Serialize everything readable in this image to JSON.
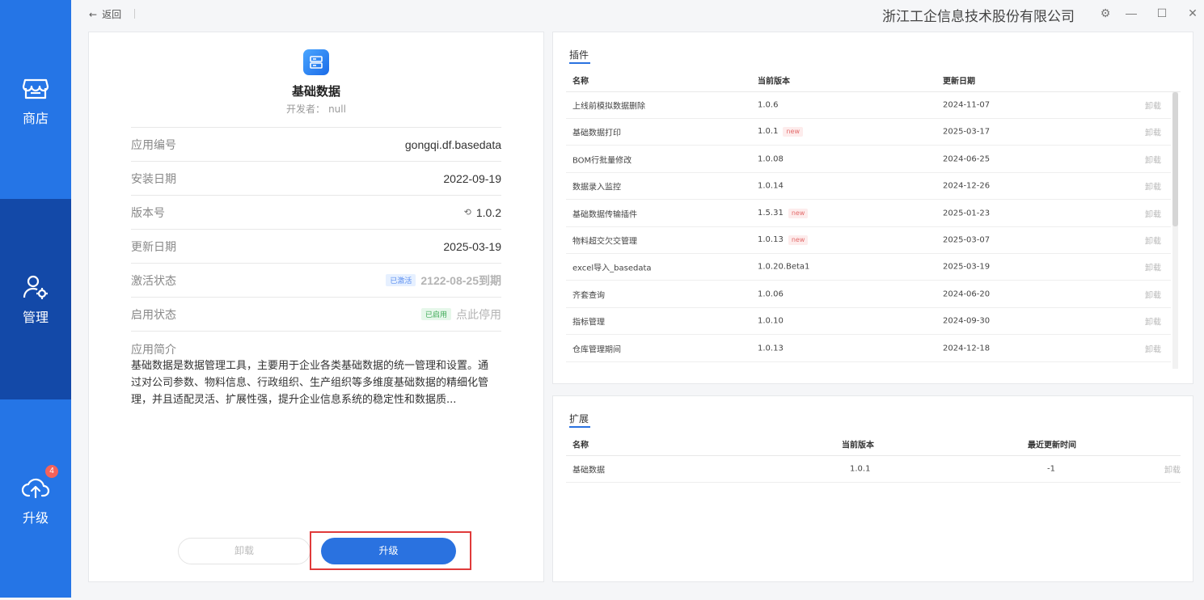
{
  "sidebar": {
    "items": [
      {
        "label": "商店",
        "icon": "store-icon"
      },
      {
        "label": "管理",
        "icon": "user-gear-icon"
      },
      {
        "label": "升级",
        "icon": "cloud-upload-icon",
        "badge": "4"
      }
    ],
    "active_index": 1,
    "colors": {
      "bg": "#2575e6",
      "active": "#1349a8"
    }
  },
  "topbar": {
    "back_label": "返回",
    "company": "浙江工企信息技术股份有限公司"
  },
  "app": {
    "name": "基础数据",
    "developer_label": "开发者：",
    "developer": "null",
    "rows": [
      {
        "key": "应用编号",
        "value": "gongqi.df.basedata"
      },
      {
        "key": "安装日期",
        "value": "2022-09-19"
      },
      {
        "key": "版本号",
        "value": "1.0.2"
      },
      {
        "key": "更新日期",
        "value": "2025-03-19"
      },
      {
        "key": "激活状态",
        "tag": "已激活",
        "value": "2122-08-25到期"
      },
      {
        "key": "启用状态",
        "tag": "已启用",
        "value": "点此停用"
      }
    ],
    "desc_title": "应用简介",
    "desc": "基础数据是数据管理工具，主要用于企业各类基础数据的统一管理和设置。通过对公司参数、物料信息、行政组织、生产组织等多维度基础数据的精细化管理，并且适配灵活、扩展性强，提升企业信息系统的稳定性和数据质...",
    "uninstall_label": "卸载",
    "upgrade_label": "升级"
  },
  "plugins": {
    "title": "插件",
    "headers": [
      "名称",
      "当前版本",
      "更新日期"
    ],
    "rows": [
      {
        "name": "上线前模拟数据删除",
        "version": "1.0.6",
        "date": "2024-11-07",
        "new": false,
        "action": "卸载"
      },
      {
        "name": "基础数据打印",
        "version": "1.0.1",
        "date": "2025-03-17",
        "new": true,
        "action": "卸载"
      },
      {
        "name": "BOM行批量修改",
        "version": "1.0.08",
        "date": "2024-06-25",
        "new": false,
        "action": "卸载"
      },
      {
        "name": "数据录入监控",
        "version": "1.0.14",
        "date": "2024-12-26",
        "new": false,
        "action": "卸载"
      },
      {
        "name": "基础数据传输插件",
        "version": "1.5.31",
        "date": "2025-01-23",
        "new": true,
        "action": "卸载"
      },
      {
        "name": "物料超交欠交管理",
        "version": "1.0.13",
        "date": "2025-03-07",
        "new": true,
        "action": "卸载"
      },
      {
        "name": "excel导入_basedata",
        "version": "1.0.20.Beta1",
        "date": "2025-03-19",
        "new": false,
        "action": "卸载"
      },
      {
        "name": "齐套查询",
        "version": "1.0.06",
        "date": "2024-06-20",
        "new": false,
        "action": "卸载"
      },
      {
        "name": "指标管理",
        "version": "1.0.10",
        "date": "2024-09-30",
        "new": false,
        "action": "卸载"
      },
      {
        "name": "仓库管理期间",
        "version": "1.0.13",
        "date": "2024-12-18",
        "new": false,
        "action": "卸载"
      }
    ],
    "new_label": "new"
  },
  "extensions": {
    "title": "扩展",
    "headers": [
      "名称",
      "当前版本",
      "最近更新时间"
    ],
    "rows": [
      {
        "name": "基础数据",
        "version": "1.0.1",
        "date": "-1",
        "action": "卸载"
      }
    ]
  }
}
